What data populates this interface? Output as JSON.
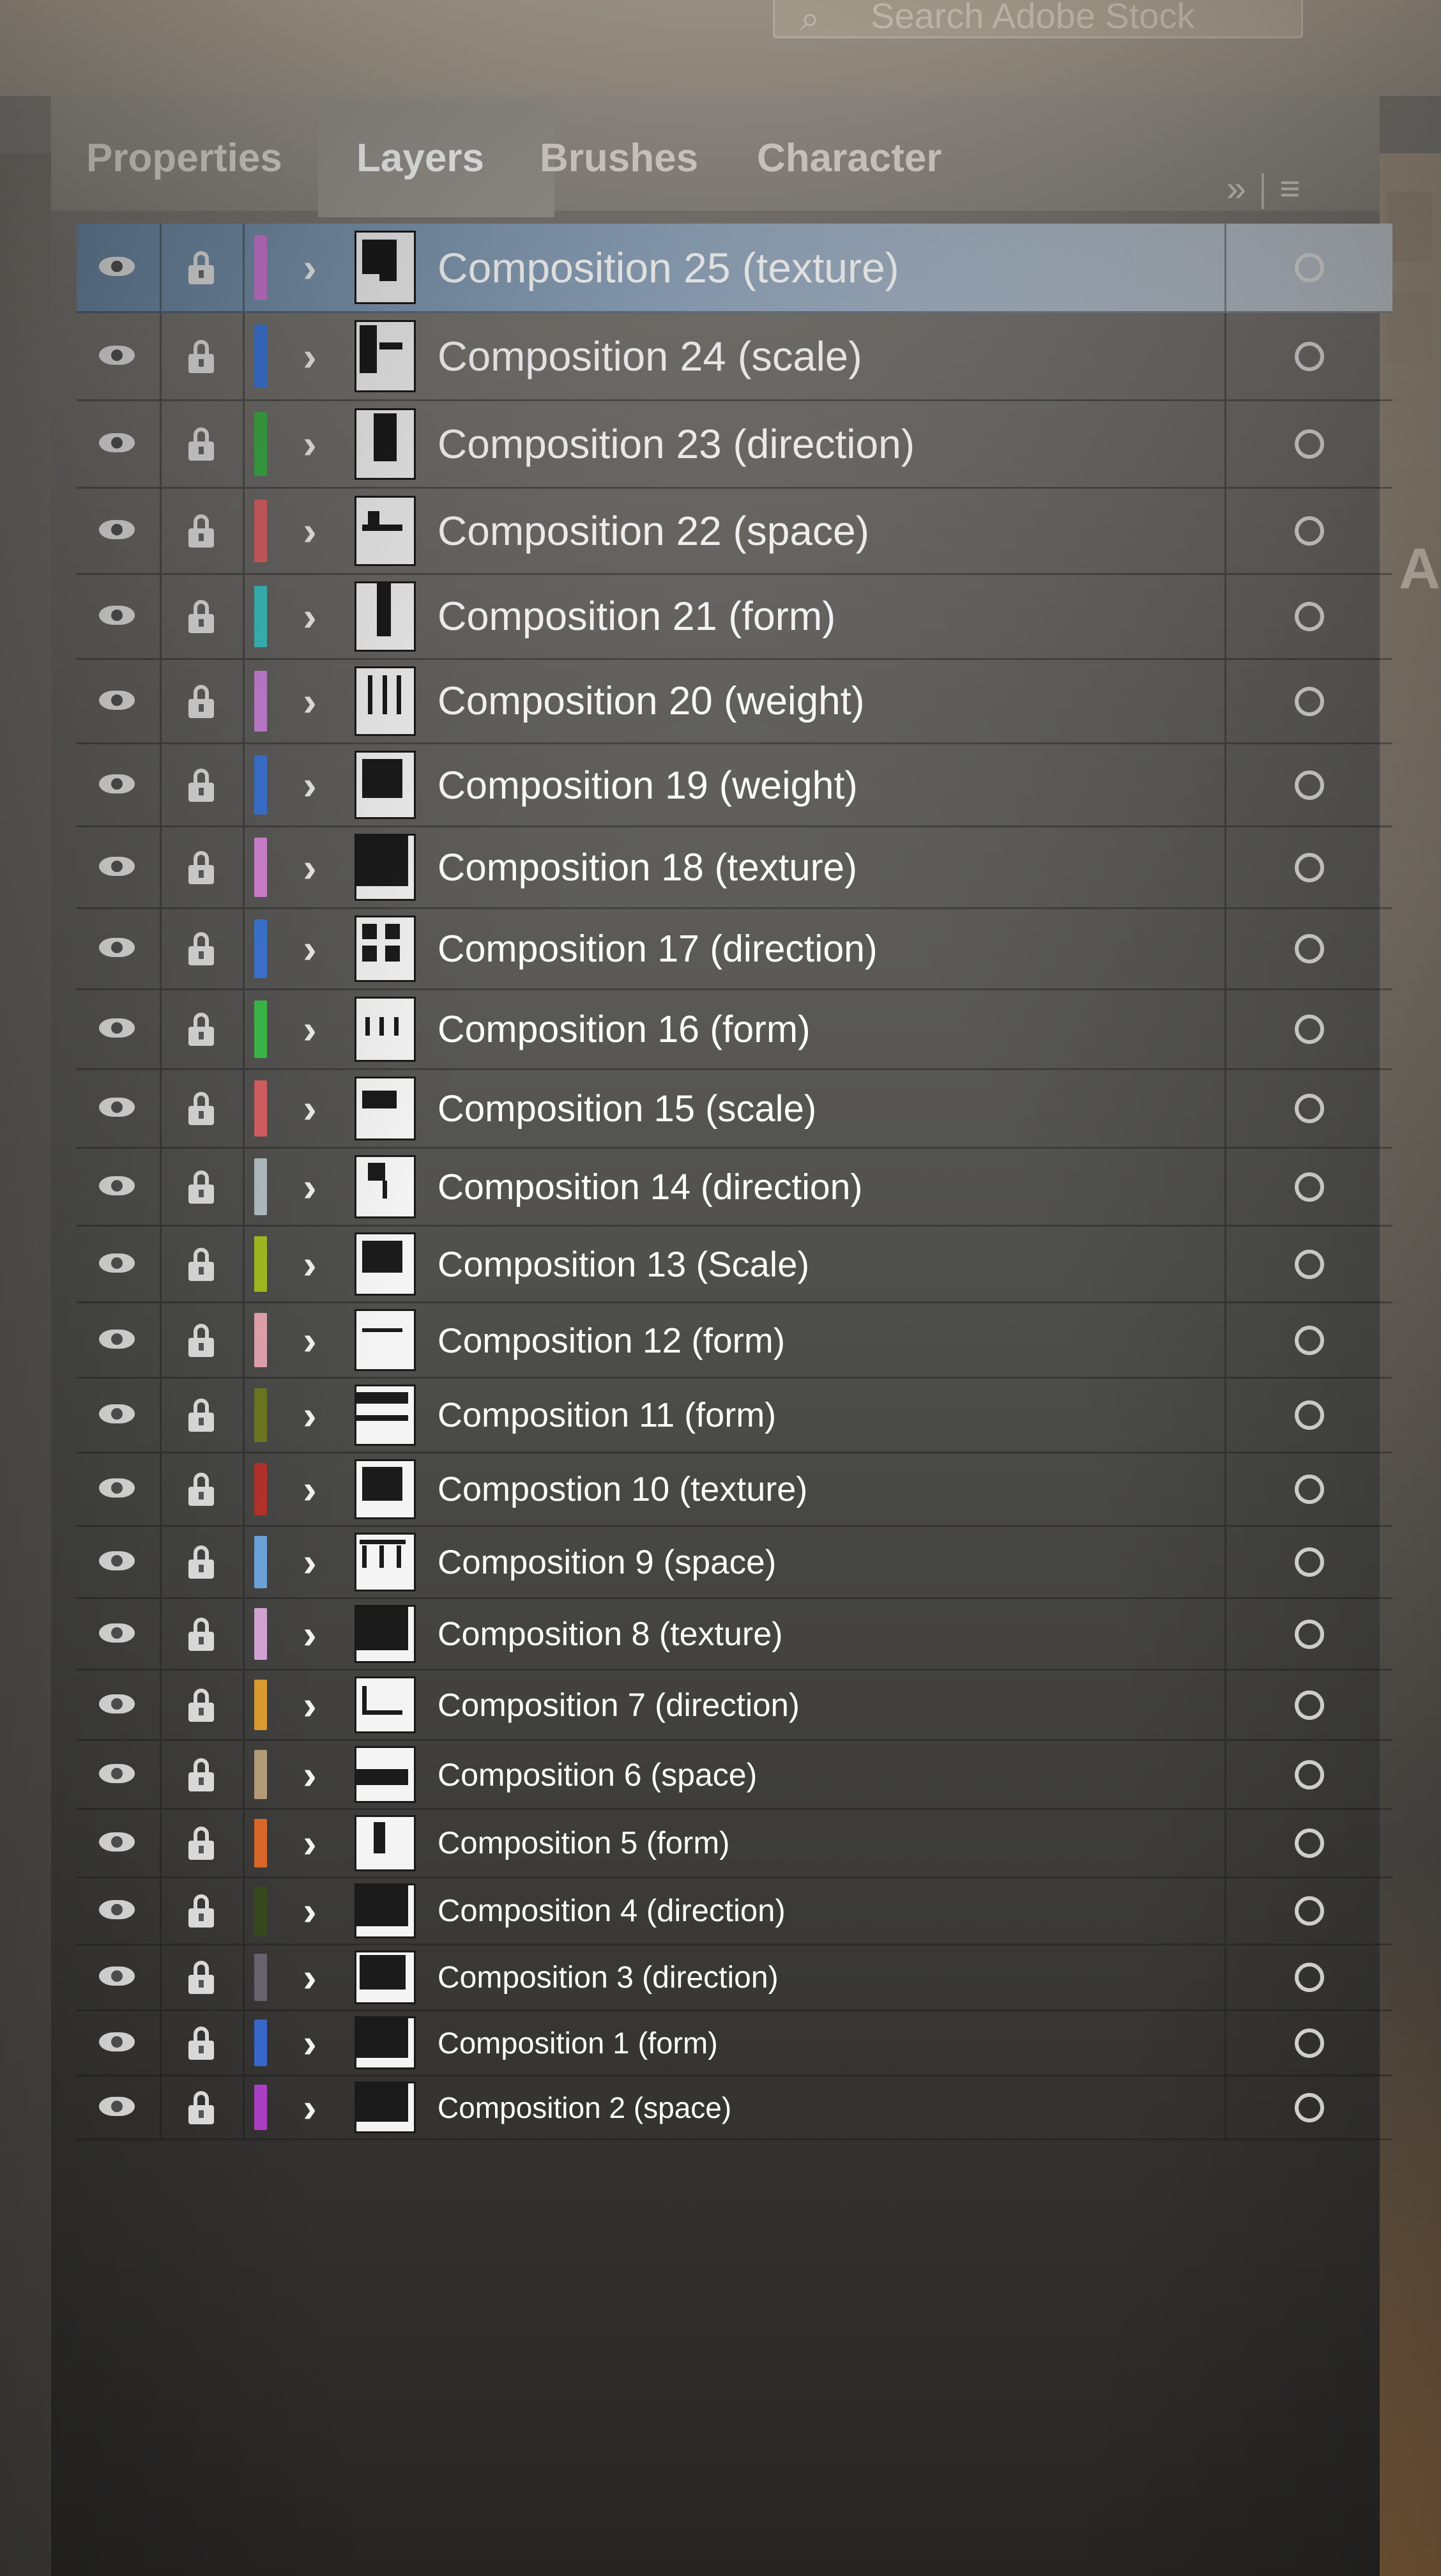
{
  "app": {
    "search_placeholder": "Search Adobe Stock"
  },
  "tabs": [
    {
      "label": "Properties",
      "active": false
    },
    {
      "label": "Layers",
      "active": true
    },
    {
      "label": "Brushes",
      "active": false
    },
    {
      "label": "Character",
      "active": false
    }
  ],
  "panel_menu": {
    "collapse_glyph": "»",
    "menu_glyph": "≡"
  },
  "right_dock_letter": "A",
  "layers": [
    {
      "name": "Composition 25 (texture)",
      "color": "#d07cd8",
      "selected": true
    },
    {
      "name": "Composition 24 (scale)",
      "color": "#3f7be0",
      "selected": false
    },
    {
      "name": "Composition 23 (direction)",
      "color": "#3fb24a",
      "selected": false
    },
    {
      "name": "Composition 22 (space)",
      "color": "#e06466",
      "selected": false
    },
    {
      "name": "Composition 21 (form)",
      "color": "#3ec7c7",
      "selected": false
    },
    {
      "name": "Composition 20 (weight)",
      "color": "#d087e0",
      "selected": false
    },
    {
      "name": "Composition 19 (weight)",
      "color": "#3f7be0",
      "selected": false
    },
    {
      "name": "Composition 18 (texture)",
      "color": "#e08be0",
      "selected": false
    },
    {
      "name": "Composition 17 (direction)",
      "color": "#3f7be0",
      "selected": false
    },
    {
      "name": "Composition 16 (form)",
      "color": "#3fc44e",
      "selected": false
    },
    {
      "name": "Composition 15 (scale)",
      "color": "#e06466",
      "selected": false
    },
    {
      "name": "Composition 14 (direction)",
      "color": "#b8c4c8",
      "selected": false
    },
    {
      "name": "Composition 13 (Scale)",
      "color": "#a8c222",
      "selected": false
    },
    {
      "name": "Composition 12 (form)",
      "color": "#e8a8b4",
      "selected": false
    },
    {
      "name": "Composition 11 (form)",
      "color": "#6f7a22",
      "selected": false
    },
    {
      "name": "Compostion 10 (texture)",
      "color": "#b8322c",
      "selected": false
    },
    {
      "name": "Composition 9 (space)",
      "color": "#6fa8e0",
      "selected": false
    },
    {
      "name": "Composition 8 (texture)",
      "color": "#d8a8d8",
      "selected": false
    },
    {
      "name": "Composition 7 (direction)",
      "color": "#e0a030",
      "selected": false
    },
    {
      "name": "Composition 6 (space)",
      "color": "#b8a07a",
      "selected": false
    },
    {
      "name": "Composition 5 (form)",
      "color": "#e06a2a",
      "selected": false
    },
    {
      "name": "Composition 4 (direction)",
      "color": "#3a4a1e",
      "selected": false
    },
    {
      "name": "Composition 3 (direction)",
      "color": "#6a6670",
      "selected": false
    },
    {
      "name": "Composition 1 (form)",
      "color": "#3a6ad0",
      "selected": false
    },
    {
      "name": "Composition 2 (space)",
      "color": "#b040c8",
      "selected": false
    }
  ]
}
